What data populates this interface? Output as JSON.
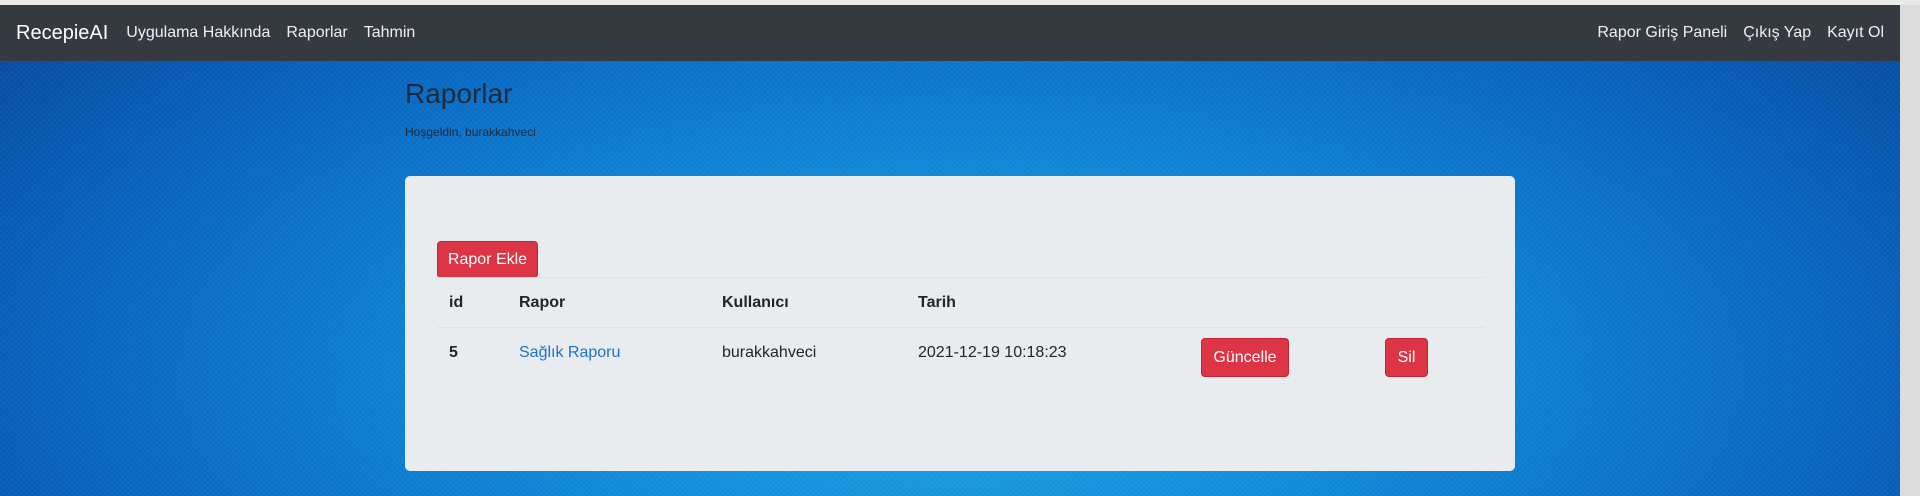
{
  "navbar": {
    "brand": "RecepieAI",
    "left_links": [
      "Uygulama Hakkında",
      "Raporlar",
      "Tahmin"
    ],
    "right_links": [
      "Rapor Giriş Paneli",
      "Çıkış Yap",
      "Kayıt Ol"
    ]
  },
  "page": {
    "title": "Raporlar",
    "welcome": "Hoşgeldin, burakkahveci"
  },
  "card": {
    "add_button": "Rapor Ekle",
    "table": {
      "headers": [
        "id",
        "Rapor",
        "Kullanıcı",
        "Tarih"
      ],
      "rows": [
        {
          "id": "5",
          "rapor": "Sağlık Raporu",
          "kullanici": "burakkahveci",
          "tarih": "2021-12-19 10:18:23",
          "update_label": "Güncelle",
          "delete_label": "Sil"
        }
      ]
    }
  },
  "colors": {
    "navbar_bg": "#343a40",
    "danger": "#dc3545",
    "link": "#1a73c9",
    "card_bg": "#e9ecef"
  }
}
